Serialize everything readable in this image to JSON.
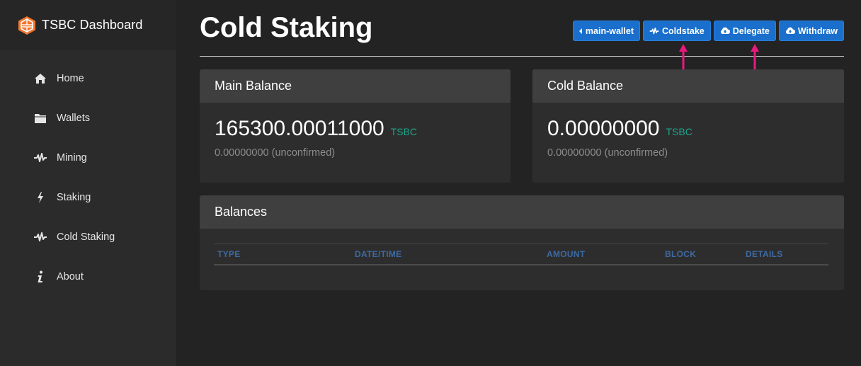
{
  "sidebar": {
    "brand_title": "TSBC Dashboard",
    "items": [
      {
        "label": "Home",
        "icon": "home-icon"
      },
      {
        "label": "Wallets",
        "icon": "folder-icon"
      },
      {
        "label": "Mining",
        "icon": "heartbeat-icon"
      },
      {
        "label": "Staking",
        "icon": "bolt-icon"
      },
      {
        "label": "Cold Staking",
        "icon": "heartbeat-icon"
      },
      {
        "label": "About",
        "icon": "info-icon"
      }
    ]
  },
  "header": {
    "title": "Cold Staking",
    "buttons": {
      "wallet": "main-wallet",
      "coldstake": "Coldstake",
      "delegate": "Delegate",
      "withdraw": "Withdraw"
    }
  },
  "main_balance": {
    "title": "Main Balance",
    "amount": "165300.00011000",
    "unit": "TSBC",
    "unconfirmed": "0.00000000 (unconfirmed)"
  },
  "cold_balance": {
    "title": "Cold Balance",
    "amount": "0.00000000",
    "unit": "TSBC",
    "unconfirmed": "0.00000000 (unconfirmed)"
  },
  "balances": {
    "title": "Balances",
    "columns": [
      "TYPE",
      "DATE/TIME",
      "AMOUNT",
      "BLOCK",
      "DETAILS"
    ]
  },
  "colors": {
    "button_blue": "#1a6fcc",
    "unit_green": "#1fa58c",
    "annotation_arrow": "#e8197f",
    "column_header": "#3d6aa4"
  }
}
